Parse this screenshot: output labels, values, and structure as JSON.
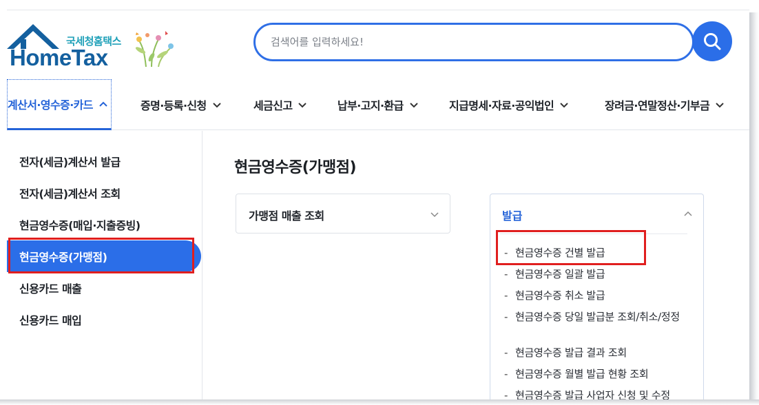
{
  "logo": {
    "korean": "국세청홈택스",
    "english": "HomeTax"
  },
  "search": {
    "placeholder": "검색어를 입력하세요!"
  },
  "topnav": [
    {
      "label": "계산서·영수증·카드",
      "state": "open"
    },
    {
      "label": "증명·등록·신청"
    },
    {
      "label": "세금신고"
    },
    {
      "label": "납부·고지·환급"
    },
    {
      "label": "지급명세·자료·공익법인"
    },
    {
      "label": "장려금·연말정산·기부금"
    }
  ],
  "sidebar": [
    {
      "label": "전자(세금)계산서 발급"
    },
    {
      "label": "전자(세금)계산서 조회"
    },
    {
      "label": "현금영수증(매입·지출증빙)"
    },
    {
      "label": "현금영수증(가맹점)",
      "active": true
    },
    {
      "label": "신용카드 매출"
    },
    {
      "label": "신용카드 매입"
    }
  ],
  "main": {
    "title": "현금영수증(가맹점)",
    "card_left": {
      "label": "가맹점 매출 조회"
    },
    "card_right": {
      "label": "발급",
      "items": [
        "현금영수증 건별 발급",
        "현금영수증 일괄 발급",
        "현금영수증 취소 발급",
        "현금영수증 당일 발급분 조회/취소/정정",
        "현금영수증 발급 결과 조회",
        "현금영수증 월별 발급 현황 조회",
        "현금영수증 발급 사업자 신청 및 수정"
      ]
    }
  },
  "colors": {
    "accent": "#2b6ee8",
    "highlight": "#e01e1e",
    "logo_blue": "#14609f",
    "logo_teal": "#1ea0b8"
  }
}
